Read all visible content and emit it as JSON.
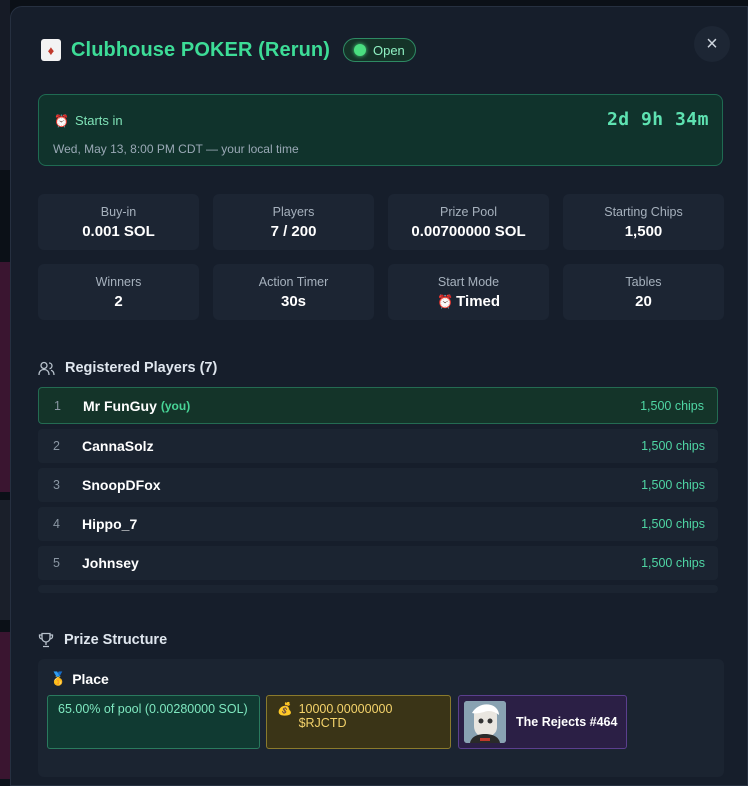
{
  "header": {
    "title": "Clubhouse POKER (Rerun)",
    "status": "Open",
    "close_glyph": "×"
  },
  "starts": {
    "label": "Starts in",
    "date": "Wed, May 13, 8:00 PM CDT — your local time",
    "countdown": "2d 9h 34m"
  },
  "stats": [
    {
      "label": "Buy-in",
      "value": "0.001 SOL"
    },
    {
      "label": "Players",
      "value": "7 / 200"
    },
    {
      "label": "Prize Pool",
      "value": "0.00700000 SOL"
    },
    {
      "label": "Starting Chips",
      "value": "1,500"
    },
    {
      "label": "Winners",
      "value": "2"
    },
    {
      "label": "Action Timer",
      "value": "30s"
    },
    {
      "label": "Start Mode",
      "value": "Timed",
      "icon": "alarm-clock-icon"
    },
    {
      "label": "Tables",
      "value": "20"
    }
  ],
  "players_section": {
    "title": "Registered Players (7)",
    "you_label": "(you)",
    "rows": [
      {
        "rank": "1",
        "name": "Mr FunGuy",
        "chips": "1,500 chips",
        "is_me": true
      },
      {
        "rank": "2",
        "name": "CannaSolz",
        "chips": "1,500 chips"
      },
      {
        "rank": "3",
        "name": "SnoopDFox",
        "chips": "1,500 chips"
      },
      {
        "rank": "4",
        "name": "Hippo_7",
        "chips": "1,500 chips"
      },
      {
        "rank": "5",
        "name": "Johnsey",
        "chips": "1,500 chips"
      }
    ]
  },
  "prize_section": {
    "title": "Prize Structure",
    "place_label": "Place",
    "pool_prize": "65.00% of pool (0.00280000 SOL)",
    "token_prize": "10000.00000000 $RJCTD",
    "nft_prize": "The Rejects #464"
  },
  "colors": {
    "accent": "#3ddc97",
    "background": "#161e2b",
    "card": "#1c2533",
    "chips": "#4fd6a4"
  }
}
